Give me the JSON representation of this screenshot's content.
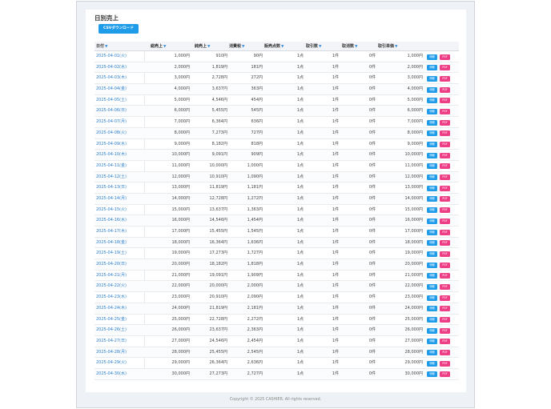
{
  "page": {
    "title": "日別売上",
    "csv_button": "CSVダウンロード",
    "footer": "Copyright © 2025 CASHIER. All rights reserved."
  },
  "table": {
    "columns": [
      "日付",
      "総売上",
      "純売上",
      "消費税",
      "販売点数",
      "取引数",
      "取消数",
      "取引単価"
    ],
    "sort_icon": "▼",
    "action_labels": {
      "detail": "明細",
      "pdf": "PDF"
    },
    "rows": [
      {
        "date": "2025-04-01(火)",
        "total": "1,000円",
        "net": "910円",
        "tax": "90円",
        "items": "1点",
        "trans": "1件",
        "cancel": "0件",
        "unit": "1,000円"
      },
      {
        "date": "2025-04-02(水)",
        "total": "2,000円",
        "net": "1,819円",
        "tax": "181円",
        "items": "1点",
        "trans": "1件",
        "cancel": "0件",
        "unit": "2,000円"
      },
      {
        "date": "2025-04-03(木)",
        "total": "3,000円",
        "net": "2,728円",
        "tax": "272円",
        "items": "1点",
        "trans": "1件",
        "cancel": "0件",
        "unit": "3,000円"
      },
      {
        "date": "2025-04-04(金)",
        "total": "4,000円",
        "net": "3,637円",
        "tax": "363円",
        "items": "1点",
        "trans": "1件",
        "cancel": "0件",
        "unit": "4,000円"
      },
      {
        "date": "2025-04-05(土)",
        "total": "5,000円",
        "net": "4,546円",
        "tax": "454円",
        "items": "1点",
        "trans": "1件",
        "cancel": "0件",
        "unit": "5,000円"
      },
      {
        "date": "2025-04-06(日)",
        "total": "6,000円",
        "net": "5,455円",
        "tax": "545円",
        "items": "1点",
        "trans": "1件",
        "cancel": "0件",
        "unit": "6,000円"
      },
      {
        "date": "2025-04-07(月)",
        "total": "7,000円",
        "net": "6,364円",
        "tax": "636円",
        "items": "1点",
        "trans": "1件",
        "cancel": "0件",
        "unit": "7,000円"
      },
      {
        "date": "2025-04-08(火)",
        "total": "8,000円",
        "net": "7,273円",
        "tax": "727円",
        "items": "1点",
        "trans": "1件",
        "cancel": "0件",
        "unit": "8,000円"
      },
      {
        "date": "2025-04-09(水)",
        "total": "9,000円",
        "net": "8,182円",
        "tax": "818円",
        "items": "1点",
        "trans": "1件",
        "cancel": "0件",
        "unit": "9,000円"
      },
      {
        "date": "2025-04-10(木)",
        "total": "10,000円",
        "net": "9,091円",
        "tax": "909円",
        "items": "1点",
        "trans": "1件",
        "cancel": "0件",
        "unit": "10,000円"
      },
      {
        "date": "2025-04-11(金)",
        "total": "11,000円",
        "net": "10,000円",
        "tax": "1,000円",
        "items": "1点",
        "trans": "1件",
        "cancel": "0件",
        "unit": "11,000円"
      },
      {
        "date": "2025-04-12(土)",
        "total": "12,000円",
        "net": "10,910円",
        "tax": "1,090円",
        "items": "1点",
        "trans": "1件",
        "cancel": "0件",
        "unit": "12,000円"
      },
      {
        "date": "2025-04-13(日)",
        "total": "13,000円",
        "net": "11,819円",
        "tax": "1,181円",
        "items": "1点",
        "trans": "1件",
        "cancel": "0件",
        "unit": "13,000円"
      },
      {
        "date": "2025-04-14(月)",
        "total": "14,000円",
        "net": "12,728円",
        "tax": "1,272円",
        "items": "1点",
        "trans": "1件",
        "cancel": "0件",
        "unit": "14,000円"
      },
      {
        "date": "2025-04-15(火)",
        "total": "15,000円",
        "net": "13,637円",
        "tax": "1,363円",
        "items": "1点",
        "trans": "1件",
        "cancel": "0件",
        "unit": "15,000円"
      },
      {
        "date": "2025-04-16(水)",
        "total": "16,000円",
        "net": "14,546円",
        "tax": "1,454円",
        "items": "1点",
        "trans": "1件",
        "cancel": "0件",
        "unit": "16,000円"
      },
      {
        "date": "2025-04-17(木)",
        "total": "17,000円",
        "net": "15,455円",
        "tax": "1,545円",
        "items": "1点",
        "trans": "1件",
        "cancel": "0件",
        "unit": "17,000円"
      },
      {
        "date": "2025-04-18(金)",
        "total": "18,000円",
        "net": "16,364円",
        "tax": "1,636円",
        "items": "1点",
        "trans": "1件",
        "cancel": "0件",
        "unit": "18,000円"
      },
      {
        "date": "2025-04-19(土)",
        "total": "19,000円",
        "net": "17,273円",
        "tax": "1,727円",
        "items": "1点",
        "trans": "1件",
        "cancel": "0件",
        "unit": "19,000円"
      },
      {
        "date": "2025-04-20(日)",
        "total": "20,000円",
        "net": "18,182円",
        "tax": "1,818円",
        "items": "1点",
        "trans": "1件",
        "cancel": "0件",
        "unit": "20,000円"
      },
      {
        "date": "2025-04-21(月)",
        "total": "21,000円",
        "net": "19,091円",
        "tax": "1,909円",
        "items": "1点",
        "trans": "1件",
        "cancel": "0件",
        "unit": "21,000円"
      },
      {
        "date": "2025-04-22(火)",
        "total": "22,000円",
        "net": "20,000円",
        "tax": "2,000円",
        "items": "1点",
        "trans": "1件",
        "cancel": "0件",
        "unit": "22,000円"
      },
      {
        "date": "2025-04-23(水)",
        "total": "23,000円",
        "net": "20,910円",
        "tax": "2,090円",
        "items": "1点",
        "trans": "1件",
        "cancel": "0件",
        "unit": "23,000円"
      },
      {
        "date": "2025-04-24(木)",
        "total": "24,000円",
        "net": "21,819円",
        "tax": "2,181円",
        "items": "1点",
        "trans": "1件",
        "cancel": "0件",
        "unit": "24,000円"
      },
      {
        "date": "2025-04-25(金)",
        "total": "25,000円",
        "net": "22,728円",
        "tax": "2,272円",
        "items": "1点",
        "trans": "1件",
        "cancel": "0件",
        "unit": "25,000円"
      },
      {
        "date": "2025-04-26(土)",
        "total": "26,000円",
        "net": "23,637円",
        "tax": "2,363円",
        "items": "1点",
        "trans": "1件",
        "cancel": "0件",
        "unit": "26,000円"
      },
      {
        "date": "2025-04-27(日)",
        "total": "27,000円",
        "net": "24,546円",
        "tax": "2,454円",
        "items": "1点",
        "trans": "1件",
        "cancel": "0件",
        "unit": "27,000円"
      },
      {
        "date": "2025-04-28(月)",
        "total": "28,000円",
        "net": "25,455円",
        "tax": "2,545円",
        "items": "1点",
        "trans": "1件",
        "cancel": "0件",
        "unit": "28,000円"
      },
      {
        "date": "2025-04-29(火)",
        "total": "29,000円",
        "net": "26,364円",
        "tax": "2,636円",
        "items": "1点",
        "trans": "1件",
        "cancel": "0件",
        "unit": "29,000円"
      },
      {
        "date": "2025-04-30(水)",
        "total": "30,000円",
        "net": "27,273円",
        "tax": "2,727円",
        "items": "1点",
        "trans": "1件",
        "cancel": "0件",
        "unit": "30,000円"
      }
    ]
  },
  "colors": {
    "accent": "#1e9be9",
    "pdf": "#ee3f86",
    "link": "#2b7fd0"
  }
}
